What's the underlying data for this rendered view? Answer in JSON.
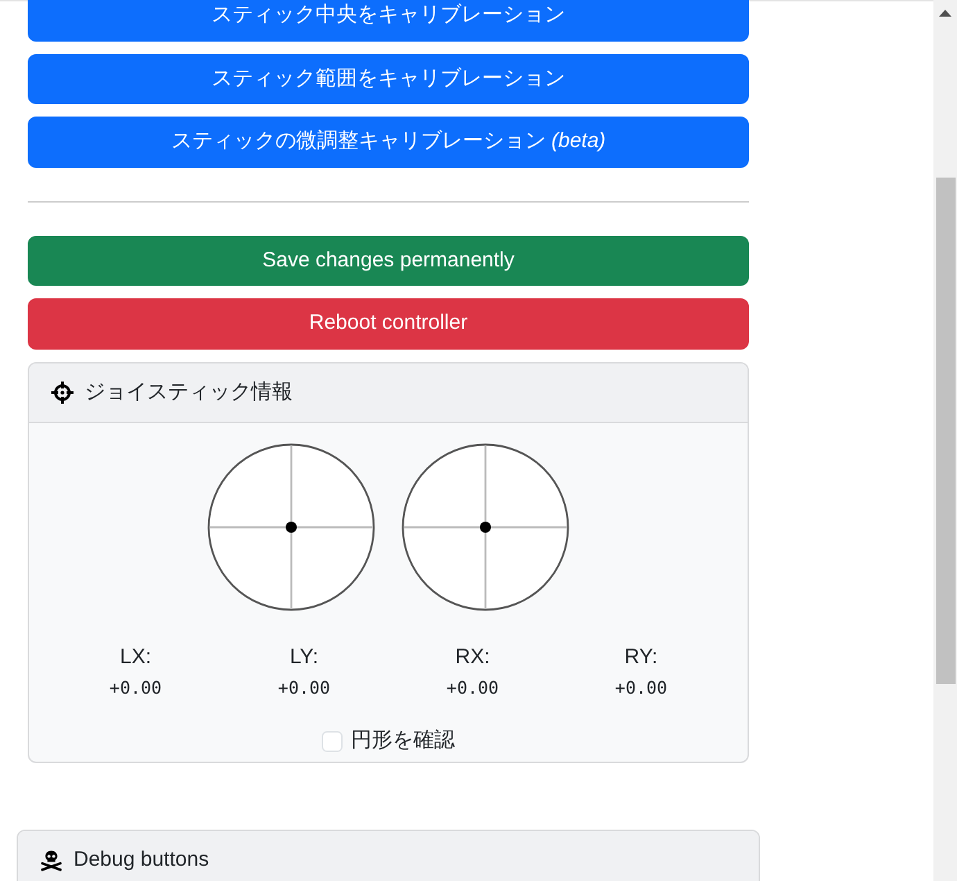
{
  "calibration_buttons": [
    {
      "label": "スティック中央をキャリブレーション",
      "kind": "primary"
    },
    {
      "label": "スティック範囲をキャリブレーション",
      "kind": "primary"
    },
    {
      "label": "スティックの微調整キャリブレーション *(beta)*",
      "kind": "primary"
    }
  ],
  "action_buttons": [
    {
      "label": "Save changes permanently",
      "kind": "success"
    },
    {
      "label": "Reboot controller",
      "kind": "danger"
    }
  ],
  "joystick_card": {
    "title": "ジョイスティック情報",
    "axes": [
      {
        "label": "LX:",
        "value": "+0.00"
      },
      {
        "label": "LY:",
        "value": "+0.00"
      },
      {
        "label": "RX:",
        "value": "+0.00"
      },
      {
        "label": "RY:",
        "value": "+0.00"
      }
    ],
    "circle_check": {
      "label": "円形を確認",
      "checked": false
    }
  },
  "debug_card": {
    "title": "Debug buttons"
  }
}
